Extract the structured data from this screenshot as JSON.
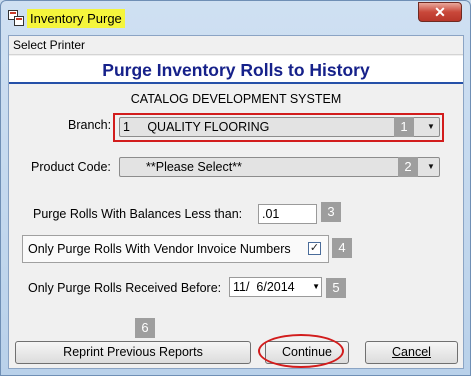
{
  "window": {
    "title": "Inventory Purge",
    "close_glyph": "✕",
    "app_icon": "app-window-icon"
  },
  "menu": {
    "item1": "Select Printer"
  },
  "header": {
    "title": "Purge Inventory Rolls to History",
    "subtitle": "CATALOG DEVELOPMENT SYSTEM"
  },
  "form": {
    "branch_label": "Branch:",
    "branch_value": "1     QUALITY FLOORING",
    "product_label": "Product Code:",
    "product_value": "**Please Select**",
    "balance_label": "Purge Rolls With Balances Less than:",
    "balance_value": ".01",
    "vendor_label": "Only Purge Rolls With Vendor Invoice Numbers",
    "vendor_checked": "✓",
    "received_label": "Only Purge Rolls Received Before:",
    "received_value": "11/  6/2014"
  },
  "badges": {
    "b1": "1",
    "b2": "2",
    "b3": "3",
    "b4": "4",
    "b5": "5",
    "b6": "6"
  },
  "buttons": {
    "reprint": "Reprint Previous Reports",
    "continue": "Continue",
    "cancel": "Cancel"
  },
  "colors": {
    "banner_text": "#16218a",
    "highlight": "#d21c1c",
    "title_highlight": "#f5f53c"
  }
}
